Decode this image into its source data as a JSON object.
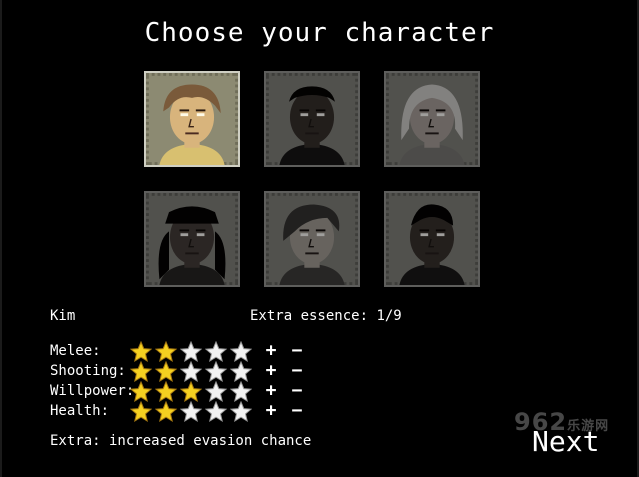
{
  "title": "Choose your character",
  "selected_name": "Kim",
  "essence": {
    "label": "Extra essence:",
    "value": "1/9"
  },
  "stat_max": 5,
  "stats": [
    {
      "name": "Melee:",
      "filled": 2
    },
    {
      "name": "Shooting:",
      "filled": 2
    },
    {
      "name": "Willpower:",
      "filled": 3
    },
    {
      "name": "Health:",
      "filled": 2
    }
  ],
  "plus_label": "+",
  "minus_label": "−",
  "extra": "Extra: increased evasion chance",
  "next_label": "Next",
  "watermark": {
    "main": "962",
    "sub": "乐游网"
  },
  "colors": {
    "star_filled": "#f5d020",
    "star_empty": "#f2f2f2",
    "background": "#000000"
  },
  "portraits": [
    {
      "skin": "#d8b47c",
      "hair": "#7a5a3a",
      "shirt": "#d8c070",
      "selected": true
    },
    {
      "skin": "#5a3a28",
      "hair": "#1c1410",
      "shirt": "#2a2622",
      "selected": false
    },
    {
      "skin": "#c9a08a",
      "hair": "#d8cfc0",
      "shirt": "#8a8070",
      "selected": false
    },
    {
      "skin": "#6a4632",
      "hair": "#1a1410",
      "shirt": "#3a3330",
      "selected": false
    },
    {
      "skin": "#c0a080",
      "hair": "#4a4038",
      "shirt": "#504a42",
      "selected": false
    },
    {
      "skin": "#5a3c2a",
      "hair": "#1a1410",
      "shirt": "#2e2824",
      "selected": false
    }
  ]
}
